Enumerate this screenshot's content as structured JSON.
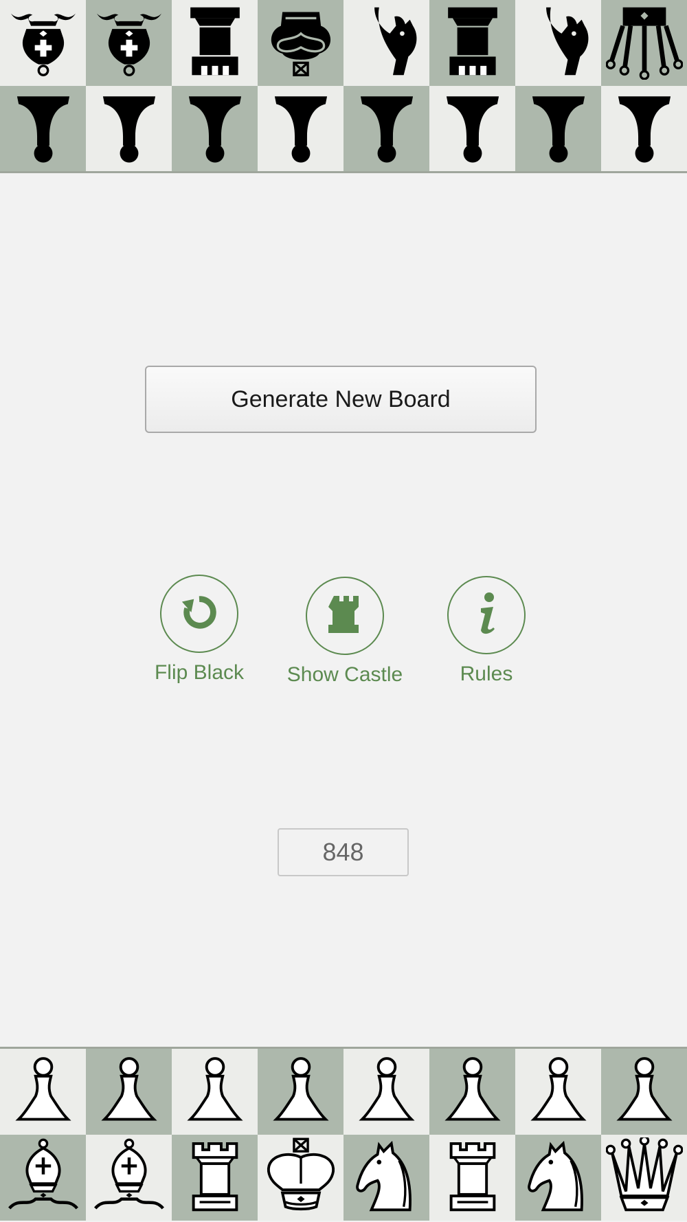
{
  "board": {
    "top_rank_pieces": [
      "black-bishop",
      "black-bishop",
      "black-rook",
      "black-king",
      "black-knight",
      "black-rook",
      "black-knight",
      "black-queen"
    ],
    "second_rank_pieces": [
      "black-pawn",
      "black-pawn",
      "black-pawn",
      "black-pawn",
      "black-pawn",
      "black-pawn",
      "black-pawn",
      "black-pawn"
    ],
    "white_pawn_rank": [
      "white-pawn",
      "white-pawn",
      "white-pawn",
      "white-pawn",
      "white-pawn",
      "white-pawn",
      "white-pawn",
      "white-pawn"
    ],
    "white_back_rank": [
      "white-bishop",
      "white-bishop",
      "white-rook",
      "white-king",
      "white-knight",
      "white-rook",
      "white-knight",
      "white-queen"
    ],
    "light_color": "#ecedea",
    "dark_color": "#adb8ac"
  },
  "generate_button": {
    "label": "Generate New Board"
  },
  "actions": {
    "flip": {
      "label": "Flip Black",
      "icon": "rotate-icon"
    },
    "castle": {
      "label": "Show Castle",
      "icon": "castle-icon"
    },
    "rules": {
      "label": "Rules",
      "icon": "info-icon"
    }
  },
  "counter": {
    "value": "848"
  },
  "accent_color": "#5c8a50"
}
